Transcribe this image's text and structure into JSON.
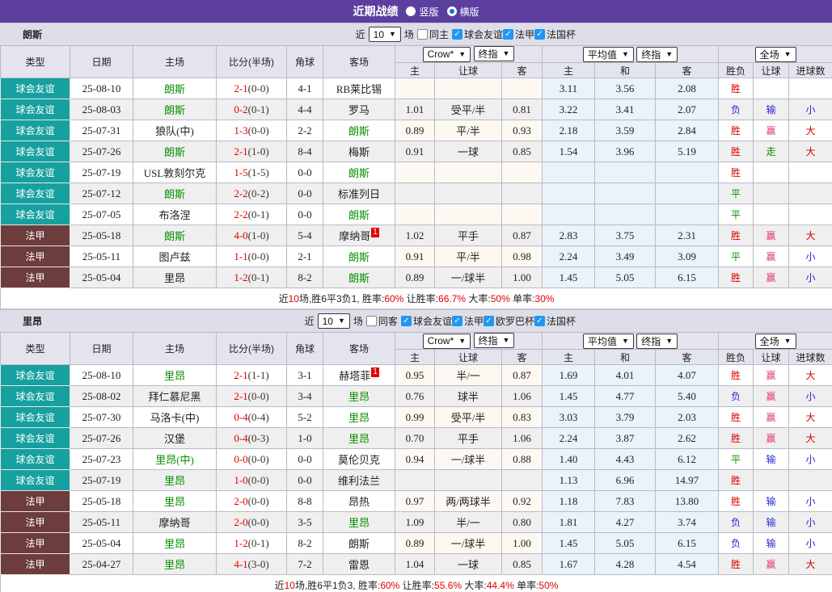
{
  "colors": {
    "purple": "#5b3e9e",
    "teal": "#17a0a0",
    "maroon": "#6d3c3c",
    "red": "#d60000",
    "blue": "#2626d6",
    "green": "#089000",
    "rose": "#e03a6e",
    "scorered": "#e00000",
    "cbblue": "#2196f3"
  },
  "title_bar": {
    "title": "近期战绩",
    "vertical_label": "竖版",
    "horizontal_label": "横版",
    "selected": "横版"
  },
  "filters": {
    "recent_prefix": "近",
    "recent_count": "10",
    "games_suffix": "场"
  },
  "dropdowns": {
    "odds_source": "Crow*",
    "final_index1": "终指",
    "average": "平均值",
    "final_index2": "终指",
    "full_match": "全场"
  },
  "columns": [
    "类型",
    "日期",
    "主场",
    "比分(半场)",
    "角球",
    "客场",
    "主",
    "让球",
    "客",
    "主",
    "和",
    "客",
    "胜负",
    "让球",
    "进球数"
  ],
  "sections": [
    {
      "team": "朗斯",
      "same_label": "同主",
      "leagues": [
        "球会友谊",
        "法甲",
        "法国杯"
      ],
      "rows": [
        {
          "t": "球会友谊",
          "tc": "f",
          "d": "25-08-10",
          "h": "朗斯",
          "hs": 1,
          "sc": "2-1",
          "hf": "(0-0)",
          "cn": "4-1",
          "a": "RB莱比锡",
          "as": 0,
          "ar": "",
          "c": [
            "",
            "",
            ""
          ],
          "v": [
            "3.11",
            "3.56",
            "2.08"
          ],
          "r": "胜",
          "hd": "",
          "g": ""
        },
        {
          "t": "球会友谊",
          "tc": "f",
          "d": "25-08-03",
          "h": "朗斯",
          "hs": 1,
          "sc": "0-2",
          "hf": "(0-1)",
          "cn": "4-4",
          "a": "罗马",
          "as": 0,
          "ar": "",
          "c": [
            "1.01",
            "受平/半",
            "0.81"
          ],
          "v": [
            "3.22",
            "3.41",
            "2.07"
          ],
          "r": "负",
          "hd": "输",
          "g": "小"
        },
        {
          "t": "球会友谊",
          "tc": "f",
          "d": "25-07-31",
          "h": "狼队(中)",
          "hs": 0,
          "sc": "1-3",
          "hf": "(0-0)",
          "cn": "2-2",
          "a": "朗斯",
          "as": 1,
          "ar": "",
          "c": [
            "0.89",
            "平/半",
            "0.93"
          ],
          "v": [
            "2.18",
            "3.59",
            "2.84"
          ],
          "r": "胜",
          "hd": "赢",
          "g": "大"
        },
        {
          "t": "球会友谊",
          "tc": "f",
          "d": "25-07-26",
          "h": "朗斯",
          "hs": 1,
          "sc": "2-1",
          "hf": "(1-0)",
          "cn": "8-4",
          "a": "梅斯",
          "as": 0,
          "ar": "",
          "c": [
            "0.91",
            "一球",
            "0.85"
          ],
          "v": [
            "1.54",
            "3.96",
            "5.19"
          ],
          "r": "胜",
          "hd": "走",
          "g": "大"
        },
        {
          "t": "球会友谊",
          "tc": "f",
          "d": "25-07-19",
          "h": "USL敦刻尔克",
          "hs": 0,
          "sc": "1-5",
          "hf": "(1-5)",
          "cn": "0-0",
          "a": "朗斯",
          "as": 1,
          "ar": "",
          "c": [
            "",
            "",
            ""
          ],
          "v": [
            "",
            "",
            ""
          ],
          "r": "胜",
          "hd": "",
          "g": ""
        },
        {
          "t": "球会友谊",
          "tc": "f",
          "d": "25-07-12",
          "h": "朗斯",
          "hs": 1,
          "sc": "2-2",
          "hf": "(0-2)",
          "cn": "0-0",
          "a": "标准列日",
          "as": 0,
          "ar": "",
          "c": [
            "",
            "",
            ""
          ],
          "v": [
            "",
            "",
            ""
          ],
          "r": "平",
          "hd": "",
          "g": ""
        },
        {
          "t": "球会友谊",
          "tc": "f",
          "d": "25-07-05",
          "h": "布洛涅",
          "hs": 0,
          "sc": "2-2",
          "hf": "(0-1)",
          "cn": "0-0",
          "a": "朗斯",
          "as": 1,
          "ar": "",
          "c": [
            "",
            "",
            ""
          ],
          "v": [
            "",
            "",
            ""
          ],
          "r": "平",
          "hd": "",
          "g": ""
        },
        {
          "t": "法甲",
          "tc": "l",
          "d": "25-05-18",
          "h": "朗斯",
          "hs": 1,
          "sc": "4-0",
          "hf": "(1-0)",
          "cn": "5-4",
          "a": "摩纳哥",
          "as": 0,
          "ar": "1",
          "c": [
            "1.02",
            "平手",
            "0.87"
          ],
          "v": [
            "2.83",
            "3.75",
            "2.31"
          ],
          "r": "胜",
          "hd": "赢",
          "g": "大"
        },
        {
          "t": "法甲",
          "tc": "l",
          "d": "25-05-11",
          "h": "图卢兹",
          "hs": 0,
          "sc": "1-1",
          "hf": "(0-0)",
          "cn": "2-1",
          "a": "朗斯",
          "as": 1,
          "ar": "",
          "c": [
            "0.91",
            "平/半",
            "0.98"
          ],
          "v": [
            "2.24",
            "3.49",
            "3.09"
          ],
          "r": "平",
          "hd": "赢",
          "g": "小"
        },
        {
          "t": "法甲",
          "tc": "l",
          "d": "25-05-04",
          "h": "里昂",
          "hs": 0,
          "sc": "1-2",
          "hf": "(0-1)",
          "cn": "8-2",
          "a": "朗斯",
          "as": 1,
          "ar": "",
          "c": [
            "0.89",
            "一/球半",
            "1.00"
          ],
          "v": [
            "1.45",
            "5.05",
            "6.15"
          ],
          "r": "胜",
          "hd": "赢",
          "g": "小"
        }
      ],
      "summary": [
        [
          "近",
          0
        ],
        [
          "10",
          1
        ],
        [
          "场,胜6平3负1, 胜率:",
          0
        ],
        [
          "60%",
          1
        ],
        [
          " 让胜率:",
          0
        ],
        [
          "66.7%",
          1
        ],
        [
          " 大率:",
          0
        ],
        [
          "50%",
          1
        ],
        [
          " 单率:",
          0
        ],
        [
          "30%",
          1
        ]
      ]
    },
    {
      "team": "里昂",
      "same_label": "同客",
      "leagues": [
        "球会友谊",
        "法甲",
        "欧罗巴杯",
        "法国杯"
      ],
      "rows": [
        {
          "t": "球会友谊",
          "tc": "f",
          "d": "25-08-10",
          "h": "里昂",
          "hs": 1,
          "sc": "2-1",
          "hf": "(1-1)",
          "cn": "3-1",
          "a": "赫塔菲",
          "as": 0,
          "ar": "1",
          "c": [
            "0.95",
            "半/一",
            "0.87"
          ],
          "v": [
            "1.69",
            "4.01",
            "4.07"
          ],
          "r": "胜",
          "hd": "赢",
          "g": "大"
        },
        {
          "t": "球会友谊",
          "tc": "f",
          "d": "25-08-02",
          "h": "拜仁慕尼黑",
          "hs": 0,
          "sc": "2-1",
          "hf": "(0-0)",
          "cn": "3-4",
          "a": "里昂",
          "as": 1,
          "ar": "",
          "c": [
            "0.76",
            "球半",
            "1.06"
          ],
          "v": [
            "1.45",
            "4.77",
            "5.40"
          ],
          "r": "负",
          "hd": "赢",
          "g": "小"
        },
        {
          "t": "球会友谊",
          "tc": "f",
          "d": "25-07-30",
          "h": "马洛卡(中)",
          "hs": 0,
          "sc": "0-4",
          "hf": "(0-4)",
          "cn": "5-2",
          "a": "里昂",
          "as": 1,
          "ar": "",
          "c": [
            "0.99",
            "受平/半",
            "0.83"
          ],
          "v": [
            "3.03",
            "3.79",
            "2.03"
          ],
          "r": "胜",
          "hd": "赢",
          "g": "大"
        },
        {
          "t": "球会友谊",
          "tc": "f",
          "d": "25-07-26",
          "h": "汉堡",
          "hs": 0,
          "sc": "0-4",
          "hf": "(0-3)",
          "cn": "1-0",
          "a": "里昂",
          "as": 1,
          "ar": "",
          "c": [
            "0.70",
            "平手",
            "1.06"
          ],
          "v": [
            "2.24",
            "3.87",
            "2.62"
          ],
          "r": "胜",
          "hd": "赢",
          "g": "大"
        },
        {
          "t": "球会友谊",
          "tc": "f",
          "d": "25-07-23",
          "h": "里昂(中)",
          "hs": 1,
          "sc": "0-0",
          "hf": "(0-0)",
          "cn": "0-0",
          "a": "莫伦贝克",
          "as": 0,
          "ar": "",
          "c": [
            "0.94",
            "一/球半",
            "0.88"
          ],
          "v": [
            "1.40",
            "4.43",
            "6.12"
          ],
          "r": "平",
          "hd": "输",
          "g": "小"
        },
        {
          "t": "球会友谊",
          "tc": "f",
          "d": "25-07-19",
          "h": "里昂",
          "hs": 1,
          "sc": "1-0",
          "hf": "(0-0)",
          "cn": "0-0",
          "a": "维利法兰",
          "as": 0,
          "ar": "",
          "c": [
            "",
            "",
            ""
          ],
          "v": [
            "1.13",
            "6.96",
            "14.97"
          ],
          "r": "胜",
          "hd": "",
          "g": ""
        },
        {
          "t": "法甲",
          "tc": "l",
          "d": "25-05-18",
          "h": "里昂",
          "hs": 1,
          "sc": "2-0",
          "hf": "(0-0)",
          "cn": "8-8",
          "a": "昂热",
          "as": 0,
          "ar": "",
          "c": [
            "0.97",
            "两/两球半",
            "0.92"
          ],
          "v": [
            "1.18",
            "7.83",
            "13.80"
          ],
          "r": "胜",
          "hd": "输",
          "g": "小"
        },
        {
          "t": "法甲",
          "tc": "l",
          "d": "25-05-11",
          "h": "摩纳哥",
          "hs": 0,
          "sc": "2-0",
          "hf": "(0-0)",
          "cn": "3-5",
          "a": "里昂",
          "as": 1,
          "ar": "",
          "c": [
            "1.09",
            "半/一",
            "0.80"
          ],
          "v": [
            "1.81",
            "4.27",
            "3.74"
          ],
          "r": "负",
          "hd": "输",
          "g": "小"
        },
        {
          "t": "法甲",
          "tc": "l",
          "d": "25-05-04",
          "h": "里昂",
          "hs": 1,
          "sc": "1-2",
          "hf": "(0-1)",
          "cn": "8-2",
          "a": "朗斯",
          "as": 0,
          "ar": "",
          "c": [
            "0.89",
            "一/球半",
            "1.00"
          ],
          "v": [
            "1.45",
            "5.05",
            "6.15"
          ],
          "r": "负",
          "hd": "输",
          "g": "小"
        },
        {
          "t": "法甲",
          "tc": "l",
          "d": "25-04-27",
          "h": "里昂",
          "hs": 1,
          "sc": "4-1",
          "hf": "(3-0)",
          "cn": "7-2",
          "a": "雷恩",
          "as": 0,
          "ar": "",
          "c": [
            "1.04",
            "一球",
            "0.85"
          ],
          "v": [
            "1.67",
            "4.28",
            "4.54"
          ],
          "r": "胜",
          "hd": "赢",
          "g": "大"
        }
      ],
      "summary": [
        [
          "近",
          0
        ],
        [
          "10",
          1
        ],
        [
          "场,胜6平1负3, 胜率:",
          0
        ],
        [
          "60%",
          1
        ],
        [
          " 让胜率:",
          0
        ],
        [
          "55.6%",
          1
        ],
        [
          " 大率:",
          0
        ],
        [
          "44.4%",
          1
        ],
        [
          " 单率:",
          0
        ],
        [
          "50%",
          1
        ]
      ]
    }
  ]
}
